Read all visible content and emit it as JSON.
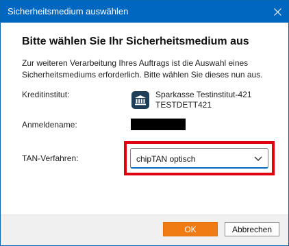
{
  "window": {
    "title": "Sicherheitsmedium auswählen",
    "close_icon": "close-icon"
  },
  "main": {
    "heading": "Bitte wählen Sie Ihr Sicherheitsmedium aus",
    "description": "Zur weiteren Verarbeitung Ihres Auftrags ist die Auswahl eines Sicherheitsmediums erforderlich. Bitte wählen Sie dieses nun aus.",
    "fields": {
      "bank": {
        "label": "Kreditinstitut:",
        "icon": "bank-icon",
        "name": "Sparkasse Testinstitut-421",
        "code": "TESTDETT421"
      },
      "login": {
        "label": "Anmeldename:"
      },
      "tan": {
        "label": "TAN-Verfahren:",
        "selected": "chipTAN optisch",
        "icon": "chevron-down-icon",
        "highlight_color": "#e0000f"
      }
    }
  },
  "footer": {
    "ok_label": "OK",
    "cancel_label": "Abbrechen"
  },
  "colors": {
    "titlebar": "#0067c0",
    "ok_button": "#f07b14",
    "bank_icon_bg": "#1f3e58"
  }
}
